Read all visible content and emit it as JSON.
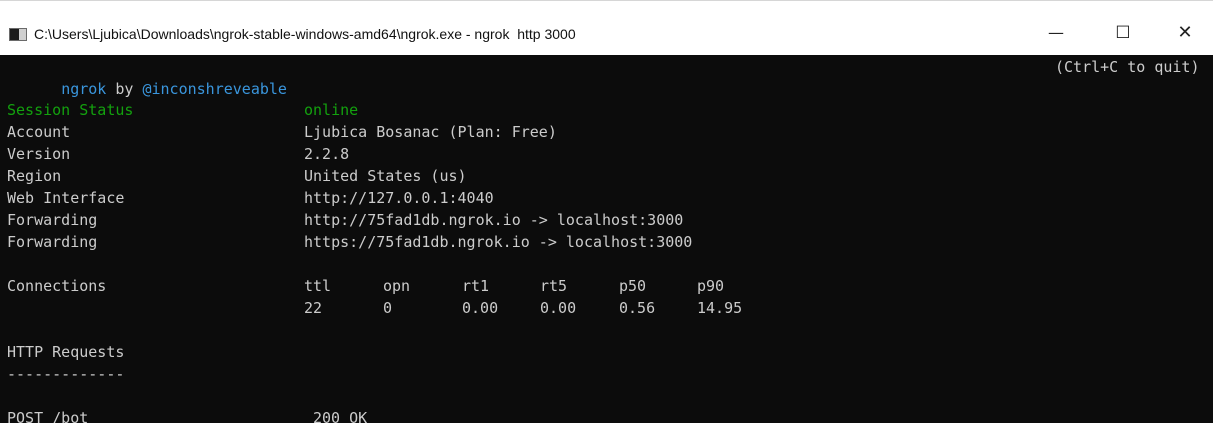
{
  "window": {
    "title": "C:\\Users\\Ljubica\\Downloads\\ngrok-stable-windows-amd64\\ngrok.exe - ngrok  http 3000",
    "icon": "console-window-icon",
    "controls": {
      "minimize": "—",
      "maximize": "☐",
      "close": "✕"
    }
  },
  "header": {
    "app_name": "ngrok",
    "by": "by",
    "author": "@inconshreveable",
    "quit_hint": "(Ctrl+C to quit)"
  },
  "session": {
    "status_label": "Session Status",
    "status_value": "online",
    "rows": [
      {
        "label": "Account",
        "value": "Ljubica Bosanac (Plan: Free)"
      },
      {
        "label": "Version",
        "value": "2.2.8"
      },
      {
        "label": "Region",
        "value": "United States (us)"
      },
      {
        "label": "Web Interface",
        "value": "http://127.0.0.1:4040"
      },
      {
        "label": "Forwarding",
        "value": "http://75fad1db.ngrok.io -> localhost:3000"
      },
      {
        "label": "Forwarding",
        "value": "https://75fad1db.ngrok.io -> localhost:3000"
      }
    ]
  },
  "connections": {
    "label": "Connections",
    "headers": [
      "ttl",
      "opn",
      "rt1",
      "rt5",
      "p50",
      "p90"
    ],
    "values": [
      "22",
      "0",
      "0.00",
      "0.00",
      "0.56",
      "14.95"
    ]
  },
  "http_requests": {
    "title": "HTTP Requests",
    "divider": "-------------",
    "requests": [
      {
        "method_path": "POST /bot",
        "status": "200 OK"
      }
    ]
  },
  "colors": {
    "background": "#0c0c0c",
    "text": "#cccccc",
    "green": "#13a10e",
    "cyan": "#3a96dd"
  }
}
